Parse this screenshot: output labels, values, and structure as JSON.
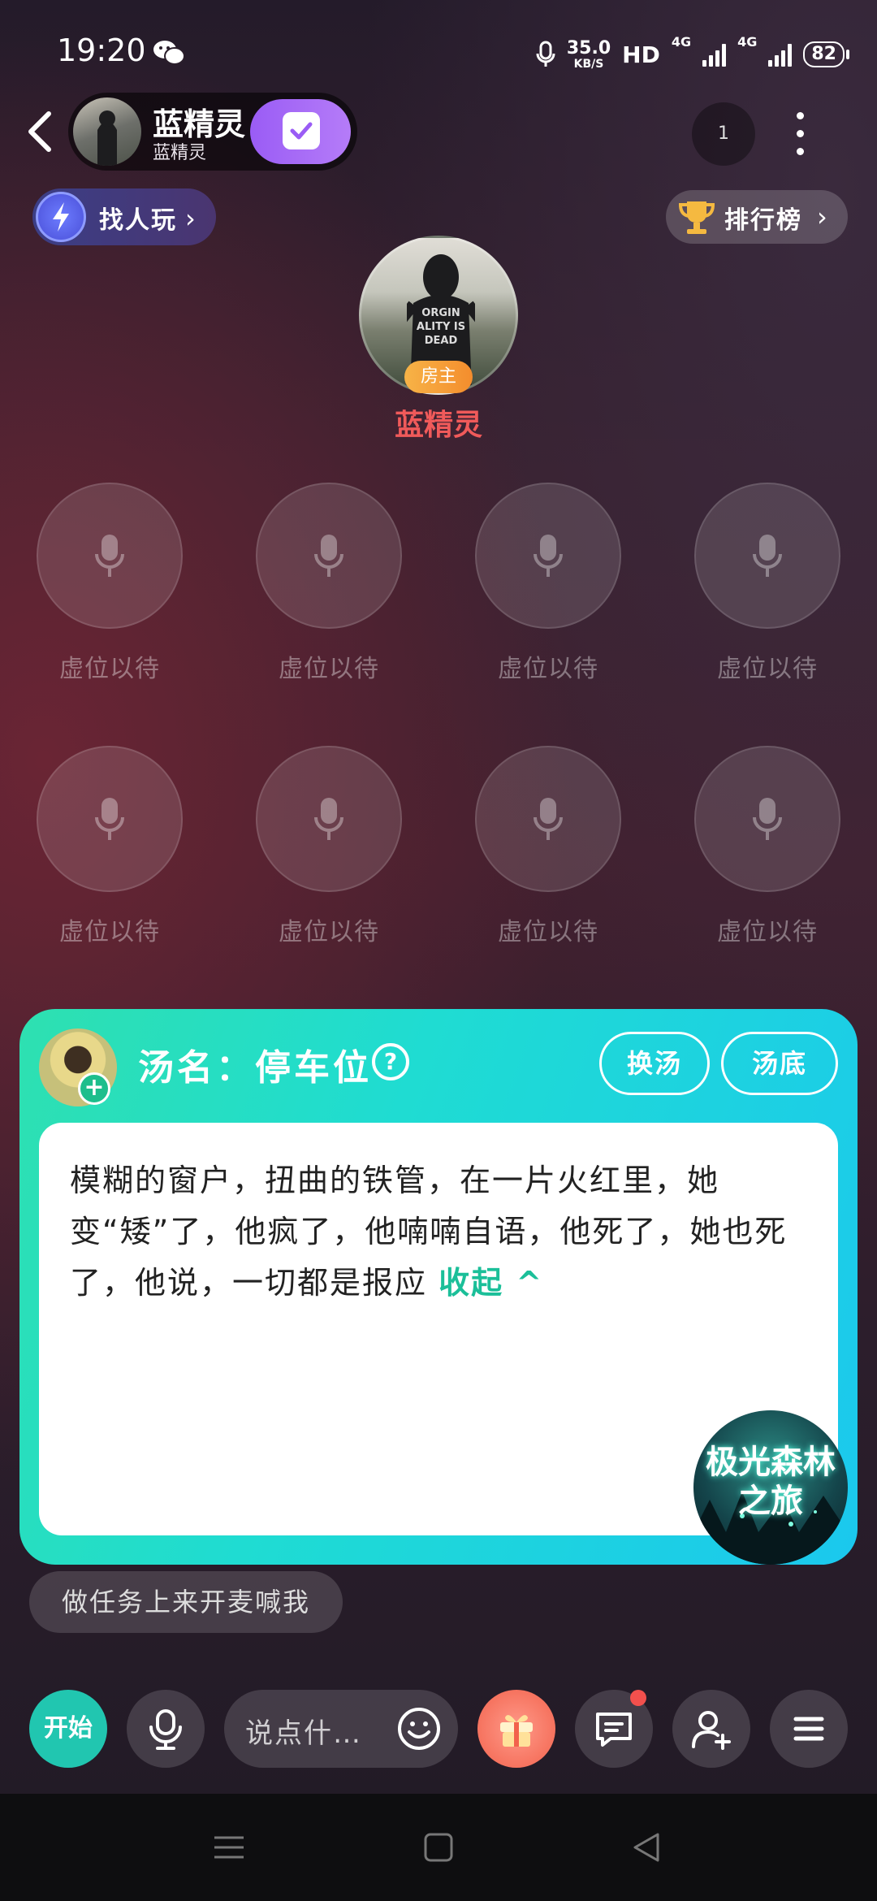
{
  "status_bar": {
    "time": "19:20",
    "speed_value": "35.0",
    "speed_unit": "KB/S",
    "hd": "HD",
    "net1": "4G",
    "net2": "4G",
    "battery": "82"
  },
  "room": {
    "name": "蓝精灵",
    "owner": "蓝精灵",
    "online_count": "1"
  },
  "find_people": "找人玩",
  "ranking": "排行榜",
  "host": {
    "badge": "房主",
    "name": "蓝精灵",
    "avatar_text": "ORGIN ALITY IS DEAD"
  },
  "seats": [
    {
      "label": "虚位以待"
    },
    {
      "label": "虚位以待"
    },
    {
      "label": "虚位以待"
    },
    {
      "label": "虚位以待"
    },
    {
      "label": "虚位以待"
    },
    {
      "label": "虚位以待"
    },
    {
      "label": "虚位以待"
    },
    {
      "label": "虚位以待"
    }
  ],
  "soup": {
    "title": "汤名：停车位",
    "help": "?",
    "swap_label": "换汤",
    "reveal_label": "汤底",
    "story": "模糊的窗户，扭曲的铁管，在一片火红里，她变“矮”了，他疯了，他喃喃自语，他死了，她也死了，他说，一切都是报应",
    "collapse_label": "收起 ^",
    "game_badge": "极光森林之旅"
  },
  "task_hint": "做任务上来开麦喊我",
  "toolbar": {
    "start_label": "开始",
    "chat_placeholder": "说点什…"
  },
  "colors": {
    "accent_teal": "#21c6b0",
    "host_name": "#f05a5a",
    "follow_purple": "#9a5cf5",
    "card_gradient_start": "#2ee0b0",
    "card_gradient_end": "#1bc8ee"
  }
}
